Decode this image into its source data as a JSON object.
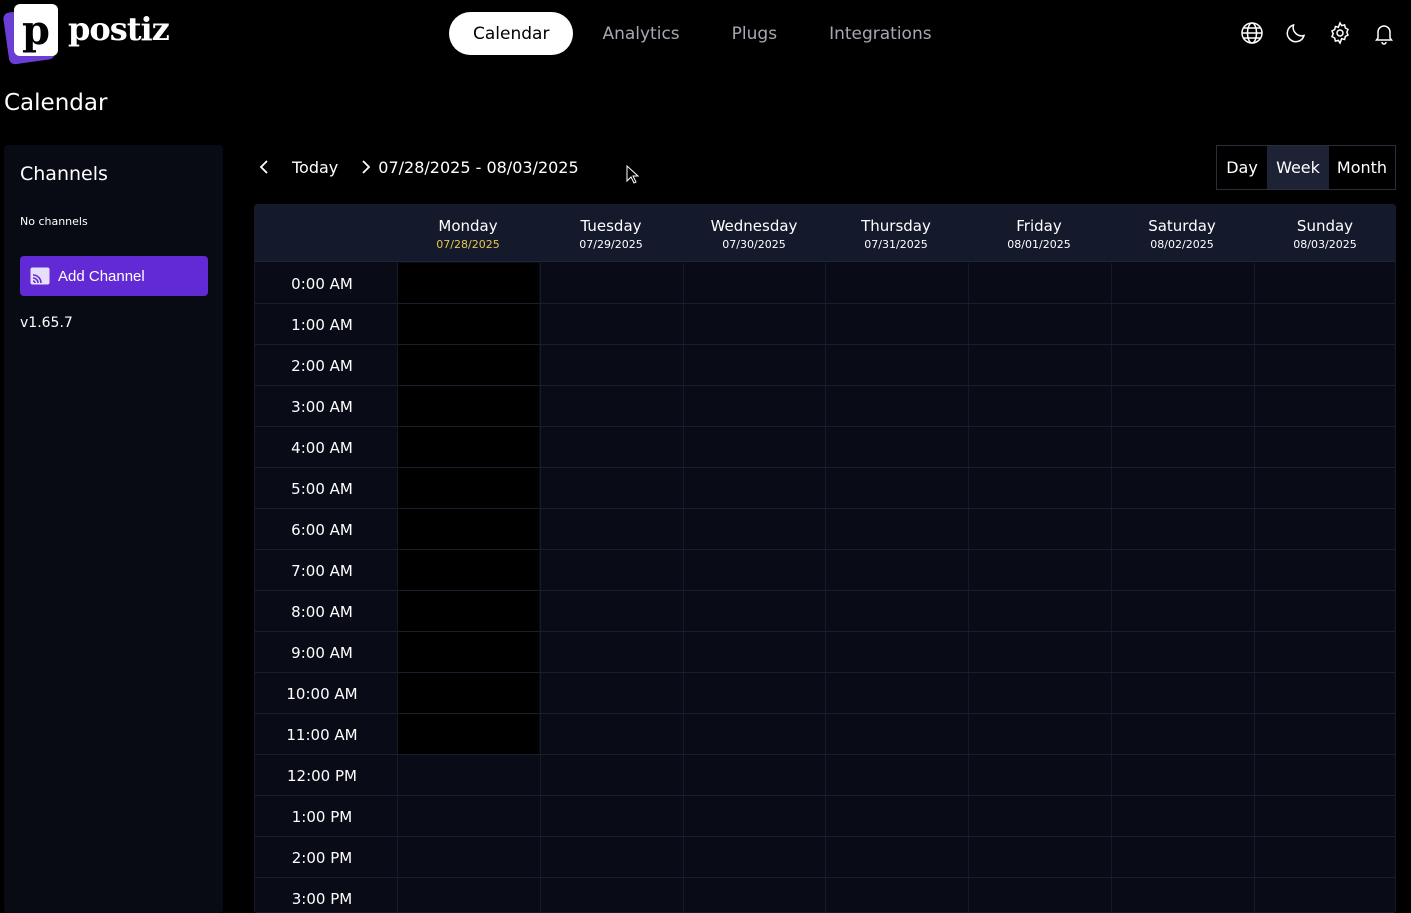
{
  "app": {
    "logo_letter": "p",
    "logo_text": "postiz"
  },
  "nav": {
    "items": [
      {
        "label": "Calendar",
        "active": true
      },
      {
        "label": "Analytics",
        "active": false
      },
      {
        "label": "Plugs",
        "active": false
      },
      {
        "label": "Integrations",
        "active": false
      }
    ]
  },
  "top_icons": [
    "globe-icon",
    "moon-icon",
    "gear-icon",
    "bell-icon"
  ],
  "page_title": "Calendar",
  "sidebar": {
    "title": "Channels",
    "empty_text": "No channels",
    "add_button": "Add Channel",
    "version": "v1.65.7"
  },
  "calendar": {
    "today_label": "Today",
    "date_range": "07/28/2025 - 08/03/2025",
    "views": [
      {
        "label": "Day",
        "active": false
      },
      {
        "label": "Week",
        "active": true
      },
      {
        "label": "Month",
        "active": false
      }
    ],
    "days": [
      {
        "name": "Monday",
        "date": "07/28/2025",
        "today": true
      },
      {
        "name": "Tuesday",
        "date": "07/29/2025",
        "today": false
      },
      {
        "name": "Wednesday",
        "date": "07/30/2025",
        "today": false
      },
      {
        "name": "Thursday",
        "date": "07/31/2025",
        "today": false
      },
      {
        "name": "Friday",
        "date": "08/01/2025",
        "today": false
      },
      {
        "name": "Saturday",
        "date": "08/02/2025",
        "today": false
      },
      {
        "name": "Sunday",
        "date": "08/03/2025",
        "today": false
      }
    ],
    "hours": [
      "0:00 AM",
      "1:00 AM",
      "2:00 AM",
      "3:00 AM",
      "4:00 AM",
      "5:00 AM",
      "6:00 AM",
      "7:00 AM",
      "8:00 AM",
      "9:00 AM",
      "10:00 AM",
      "11:00 AM",
      "12:00 PM",
      "1:00 PM",
      "2:00 PM",
      "3:00 PM"
    ],
    "past_hours_monday": 12
  },
  "colors": {
    "accent": "#612ad5",
    "today_date": "#e7c74d",
    "active_view": "#1e2235",
    "header_bg": "#141a2c",
    "grid_bg": "#090c17"
  }
}
